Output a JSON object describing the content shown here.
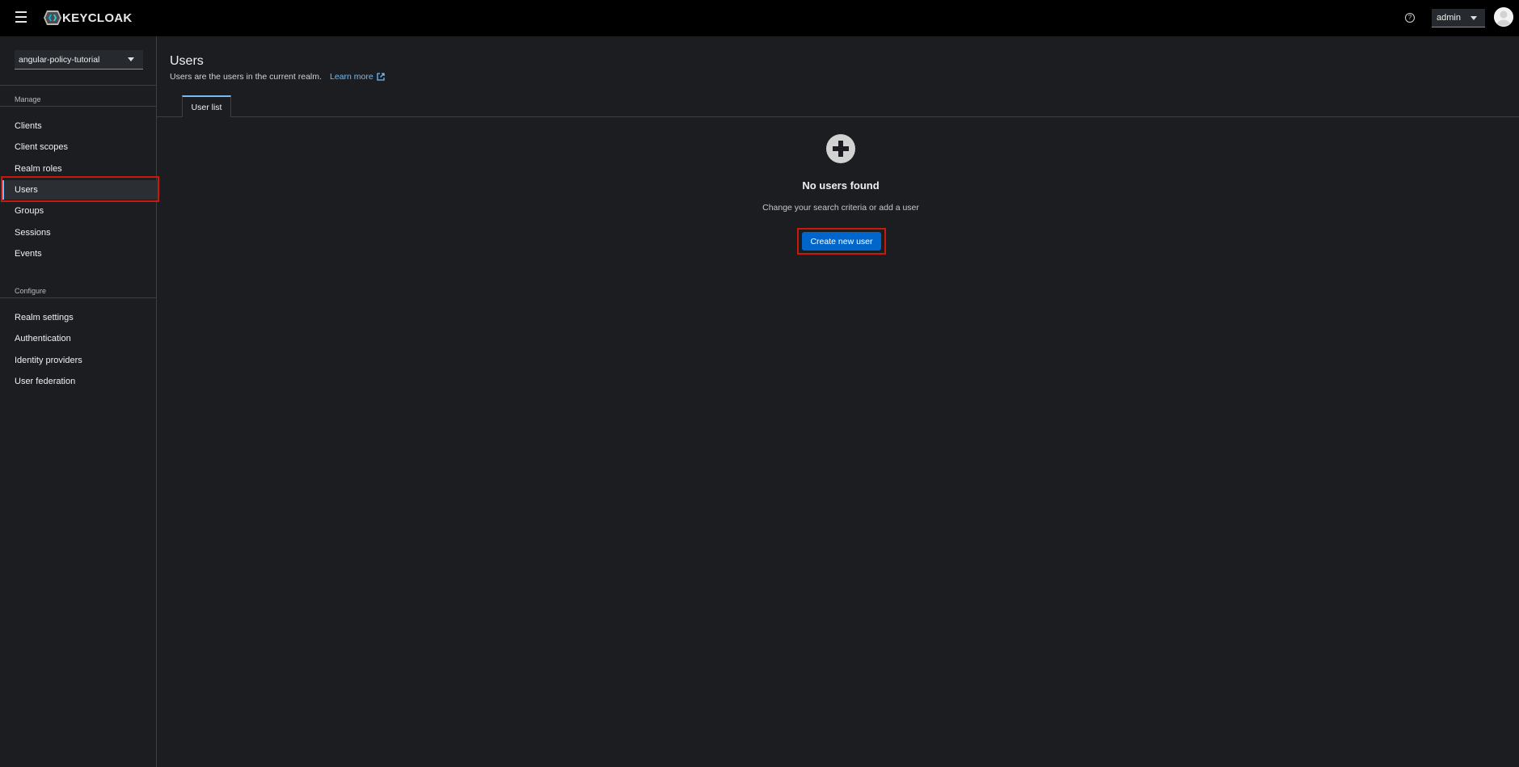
{
  "header": {
    "brand_bold": "KEYCLOAK",
    "user_label": "admin",
    "icons": {
      "menu": "hamburger-icon",
      "help": "help-icon",
      "avatar": "user-avatar-icon"
    }
  },
  "sidebar": {
    "realm": "angular-policy-tutorial",
    "sections": [
      {
        "title": "Manage",
        "items": [
          "Clients",
          "Client scopes",
          "Realm roles",
          "Users",
          "Groups",
          "Sessions",
          "Events"
        ]
      },
      {
        "title": "Configure",
        "items": [
          "Realm settings",
          "Authentication",
          "Identity providers",
          "User federation"
        ]
      }
    ],
    "active_item": "Users"
  },
  "main": {
    "title": "Users",
    "description": "Users are the users in the current realm.",
    "learn_more": "Learn more",
    "tabs": [
      {
        "label": "User list",
        "active": true
      }
    ],
    "empty_state": {
      "icon": "add-circle-icon",
      "title": "No users found",
      "body": "Change your search criteria or add a user",
      "button": "Create new user"
    }
  },
  "colors": {
    "header_bg": "#000000",
    "page_bg": "#1b1d21",
    "accent_link": "#73bcf7",
    "primary_button": "#0066cc",
    "highlight": "#c9190b"
  }
}
